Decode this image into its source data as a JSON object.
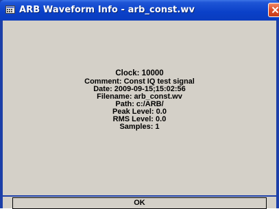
{
  "window": {
    "title": "ARB Waveform Info - arb_const.wv",
    "title_icon": "app-icon",
    "close_icon": "close-icon",
    "colors": {
      "titlebar": "#0a40c8",
      "close_button": "#e0502a",
      "client_background": "#d4d0c8"
    }
  },
  "info": {
    "clock": "Clock: 10000",
    "comment": "Comment: Const IQ test signal",
    "date": "Date: 2009-09-15;15:02:56",
    "filename": "Filename: arb_const.wv",
    "path": "Path: c:/ARB/",
    "peak_level": "Peak Level: 0.0",
    "rms_level": "RMS Level: 0.0",
    "samples": "Samples: 1"
  },
  "buttons": {
    "ok_label": "OK"
  }
}
